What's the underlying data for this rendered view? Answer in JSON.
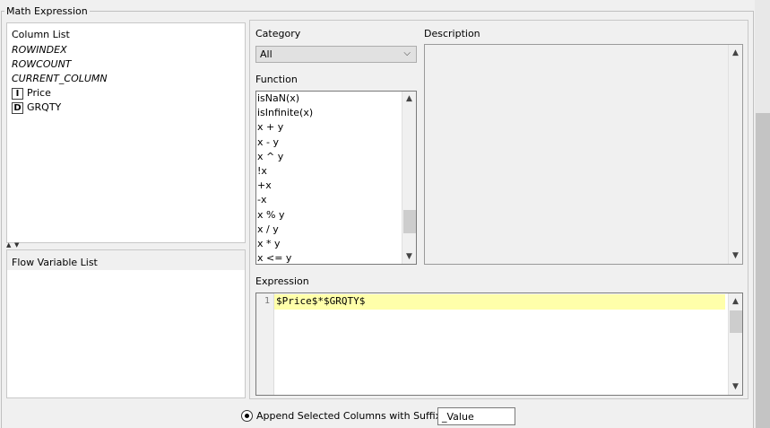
{
  "dialog": {
    "section_title": "Math Expression"
  },
  "column_list": {
    "header": "Column List",
    "items": [
      {
        "label": "ROWINDEX",
        "italic": true,
        "type": ""
      },
      {
        "label": "ROWCOUNT",
        "italic": true,
        "type": ""
      },
      {
        "label": "CURRENT_COLUMN",
        "italic": true,
        "type": ""
      },
      {
        "label": "Price",
        "italic": false,
        "type": "I"
      },
      {
        "label": "GRQTY",
        "italic": false,
        "type": "D"
      }
    ]
  },
  "flow_variable_list": {
    "header": "Flow Variable List"
  },
  "category": {
    "label": "Category",
    "selected": "All"
  },
  "description": {
    "label": "Description"
  },
  "function": {
    "label": "Function",
    "items": [
      "isNaN(x)",
      "isInfinite(x)",
      "x + y",
      "x - y",
      "x ^ y",
      "!x",
      "+x",
      "-x",
      "x % y",
      "x / y",
      "x * y",
      "x <= y"
    ]
  },
  "expression": {
    "label": "Expression",
    "line_number": "1",
    "text": "$Price$*$GRQTY$"
  },
  "append": {
    "label": "Append Selected Columns with Suffix:",
    "suffix_value": "_Value"
  },
  "colors": {
    "highlight": "#ffffaa",
    "background": "#f0f0f0"
  }
}
